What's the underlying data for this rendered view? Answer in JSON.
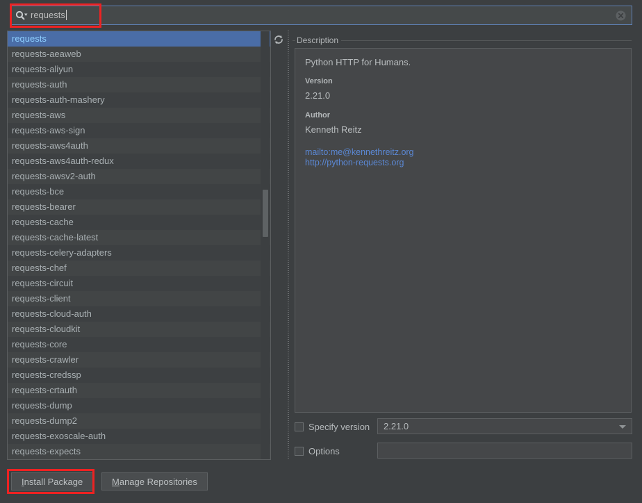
{
  "search": {
    "value": "requests",
    "placeholder": "",
    "search_icon": "search-icon",
    "dropdown_icon": "chevron-down-icon",
    "clear_icon": "clear-circle-icon"
  },
  "list": {
    "refresh_icon": "refresh-icon",
    "selected_index": 0,
    "items": [
      "requests",
      "requests-aeaweb",
      "requests-aliyun",
      "requests-auth",
      "requests-auth-mashery",
      "requests-aws",
      "requests-aws-sign",
      "requests-aws4auth",
      "requests-aws4auth-redux",
      "requests-awsv2-auth",
      "requests-bce",
      "requests-bearer",
      "requests-cache",
      "requests-cache-latest",
      "requests-celery-adapters",
      "requests-chef",
      "requests-circuit",
      "requests-client",
      "requests-cloud-auth",
      "requests-cloudkit",
      "requests-core",
      "requests-crawler",
      "requests-credssp",
      "requests-crtauth",
      "requests-dump",
      "requests-dump2",
      "requests-exoscale-auth",
      "requests-expects"
    ]
  },
  "description": {
    "title": "Description",
    "summary": "Python HTTP for Humans.",
    "version_label": "Version",
    "version_value": "2.21.0",
    "author_label": "Author",
    "author_value": "Kenneth Reitz",
    "links": [
      "mailto:me@kennethreitz.org",
      "http://python-requests.org"
    ]
  },
  "options": {
    "specify_version_label": "Specify version",
    "specify_version_checked": false,
    "version_value": "2.21.0",
    "options_label": "Options",
    "options_checked": false,
    "options_value": "",
    "combo_icon": "chevron-down-icon"
  },
  "footer": {
    "install_label_pre": "",
    "install_mnemonic": "I",
    "install_label_post": "nstall Package",
    "manage_label_pre": "",
    "manage_mnemonic": "M",
    "manage_label_post": "anage Repositories"
  },
  "colors": {
    "background": "#3c3f41",
    "selection": "#4a6da7",
    "link": "#5b88d4",
    "annotation": "#ee2222",
    "row_odd": "#3d4042",
    "row_even": "#424546"
  }
}
